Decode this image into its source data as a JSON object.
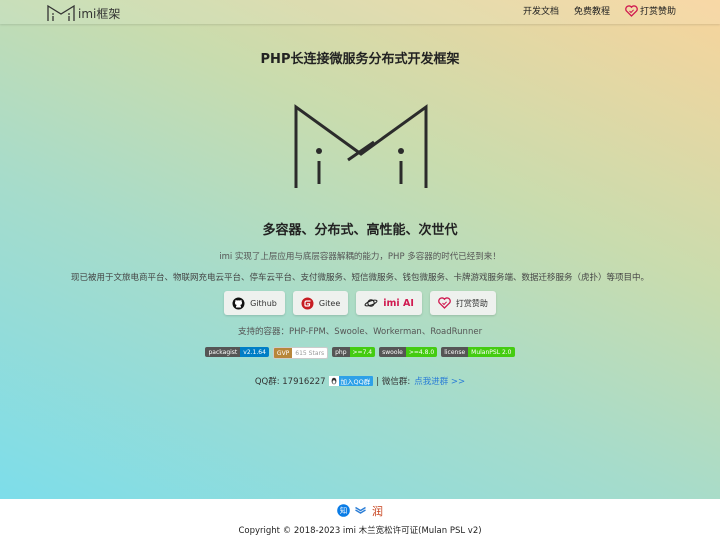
{
  "brand": {
    "name": "imi框架"
  },
  "nav": {
    "docs": "开发文档",
    "tutorial": "免费教程",
    "sponsor": "打赏赞助"
  },
  "hero": {
    "title": "PHP长连接微服务分布式开发框架",
    "slogan": "多容器、分布式、高性能、次世代",
    "intro": "imi 实现了上层应用与底层容器解耦的能力，PHP 多容器的时代已经到来！",
    "usage": "现已被用于文旅电商平台、物联网充电云平台、停车云平台、支付微服务、短信微服务、钱包微服务、卡牌游戏服务端、数据迁移服务（虎扑）等项目中。"
  },
  "buttons": {
    "github": "Github",
    "gitee": "Gitee",
    "ai": "imi AI",
    "sponsor": "打赏赞助"
  },
  "containers": "支持的容器：PHP-FPM、Swoole、Workerman、RoadRunner",
  "badges": [
    {
      "label": "packagist",
      "value": "v2.1.64",
      "color": "#007ec6"
    },
    {
      "label": "GVP",
      "value": "615 Stars",
      "color": "#fff"
    },
    {
      "label": "php",
      "value": ">=7.4",
      "color": "#4c1"
    },
    {
      "label": "swoole",
      "value": ">=4.8.0",
      "color": "#4c1"
    },
    {
      "label": "license",
      "value": "MulanPSL 2.0",
      "color": "#4c1"
    }
  ],
  "contact": {
    "qq_label": "QQ群: 17916227",
    "qq_button": "加入QQ群",
    "wechat_label": "| 微信群:",
    "wechat_link": "点我进群 >>"
  },
  "footer": {
    "copyright": "Copyright © 2018-2023 imi 木兰宽松许可证(Mulan PSL v2)"
  },
  "colors": {
    "accent": "#d01a50",
    "link": "#2a7dd6",
    "qq": "#2ea1e8"
  }
}
